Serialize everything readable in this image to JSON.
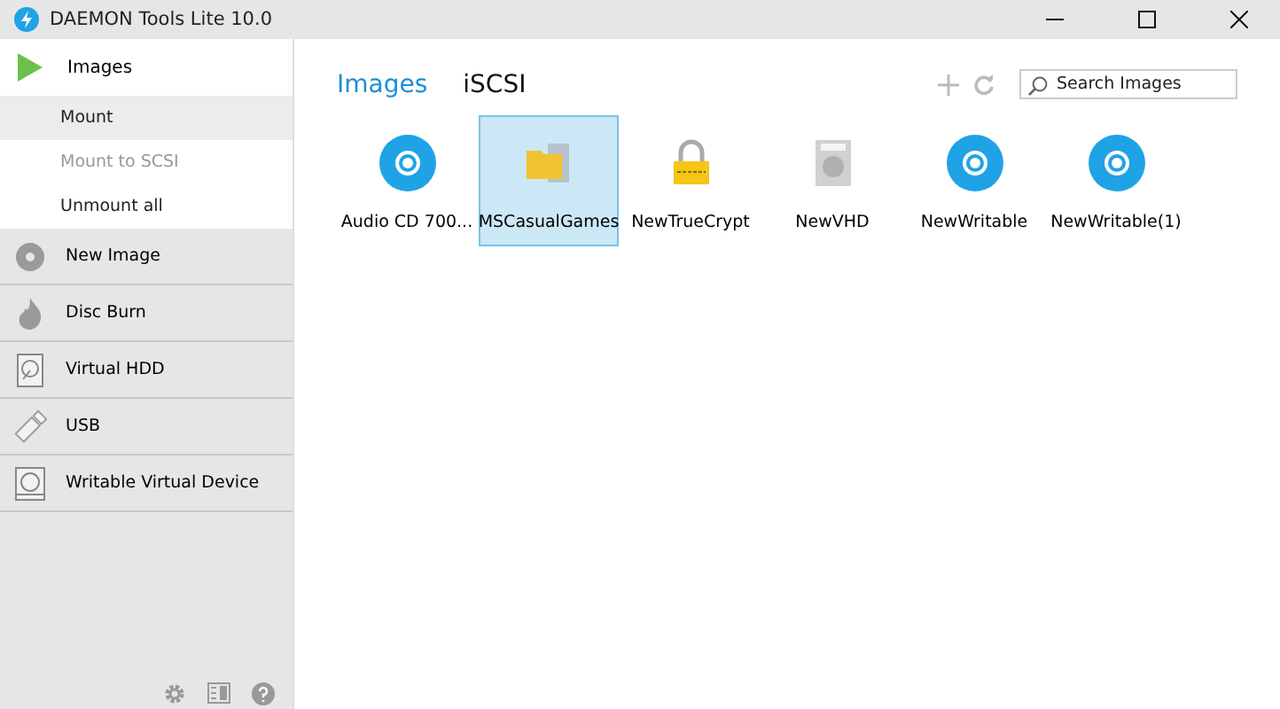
{
  "window": {
    "title": "DAEMON Tools Lite 10.0"
  },
  "sidebar": {
    "section": {
      "label": "Images",
      "expanded": true,
      "items": [
        {
          "label": "Mount",
          "selected": true,
          "disabled": false
        },
        {
          "label": "Mount to SCSI",
          "selected": false,
          "disabled": true
        },
        {
          "label": "Unmount all",
          "selected": false,
          "disabled": false
        }
      ]
    },
    "items": [
      {
        "label": "New Image",
        "kind": "disc"
      },
      {
        "label": "Disc Burn",
        "kind": "flame"
      },
      {
        "label": "Virtual HDD",
        "kind": "hdd"
      },
      {
        "label": "USB",
        "kind": "usb"
      },
      {
        "label": "Writable Virtual Device",
        "kind": "writable"
      }
    ]
  },
  "tabs": [
    {
      "label": "Images",
      "selected": true
    },
    {
      "label": "iSCSI",
      "selected": false
    }
  ],
  "search": {
    "placeholder": "Search Images"
  },
  "images": [
    {
      "label": "Audio CD 700...",
      "kind": "disc",
      "selected": false
    },
    {
      "label": "MSCasualGames",
      "kind": "zip",
      "selected": true
    },
    {
      "label": "NewTrueCrypt",
      "kind": "lock",
      "selected": false
    },
    {
      "label": "NewVHD",
      "kind": "vhd",
      "selected": false
    },
    {
      "label": "NewWritable",
      "kind": "disc",
      "selected": false
    },
    {
      "label": "NewWritable(1)",
      "kind": "disc",
      "selected": false
    }
  ]
}
